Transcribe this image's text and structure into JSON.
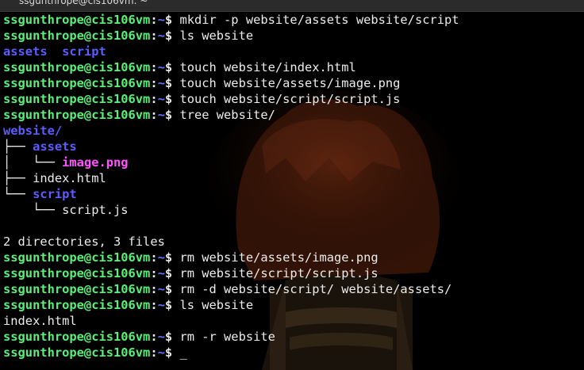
{
  "window": {
    "title": "ssgunthrope@cis106vm: ~"
  },
  "prompt": {
    "user_host": "ssgunthrope@cis106vm",
    "sep": ":",
    "path": "~",
    "symbol": "$ "
  },
  "colors": {
    "prompt_user": "#5af078",
    "prompt_path": "#5c78ff",
    "directory": "#5c5cff",
    "image_file": "#ff55ff",
    "text": "#e8e8e8",
    "background": "#000000"
  },
  "lines": [
    {
      "type": "prompt",
      "command": "mkdir -p website/assets website/script"
    },
    {
      "type": "prompt",
      "command": "ls website"
    },
    {
      "type": "output",
      "segments": [
        {
          "text": "assets",
          "style": "dir"
        },
        {
          "text": "  ",
          "style": "txt"
        },
        {
          "text": "script",
          "style": "dir"
        }
      ]
    },
    {
      "type": "prompt",
      "command": "touch website/index.html"
    },
    {
      "type": "prompt",
      "command": "touch website/assets/image.png"
    },
    {
      "type": "prompt",
      "command": "touch website/script/script.js"
    },
    {
      "type": "prompt",
      "command": "tree website/"
    },
    {
      "type": "output",
      "segments": [
        {
          "text": "website/",
          "style": "dir"
        }
      ]
    },
    {
      "type": "output",
      "segments": [
        {
          "text": "├── ",
          "style": "txt"
        },
        {
          "text": "assets",
          "style": "dir"
        }
      ]
    },
    {
      "type": "output",
      "segments": [
        {
          "text": "│   └── ",
          "style": "txt"
        },
        {
          "text": "image.png",
          "style": "img"
        }
      ]
    },
    {
      "type": "output",
      "segments": [
        {
          "text": "├── index.html",
          "style": "txt"
        }
      ]
    },
    {
      "type": "output",
      "segments": [
        {
          "text": "└── ",
          "style": "txt"
        },
        {
          "text": "script",
          "style": "dir"
        }
      ]
    },
    {
      "type": "output",
      "segments": [
        {
          "text": "    └── script.js",
          "style": "txt"
        }
      ]
    },
    {
      "type": "output",
      "segments": [
        {
          "text": "",
          "style": "txt"
        }
      ]
    },
    {
      "type": "output",
      "segments": [
        {
          "text": "2 directories, 3 files",
          "style": "txt"
        }
      ]
    },
    {
      "type": "prompt",
      "command": "rm website/assets/image.png"
    },
    {
      "type": "prompt",
      "command": "rm website/script/script.js"
    },
    {
      "type": "prompt",
      "command": "rm -d website/script/ website/assets/"
    },
    {
      "type": "prompt",
      "command": "ls website"
    },
    {
      "type": "output",
      "segments": [
        {
          "text": "index.html",
          "style": "txt"
        }
      ]
    },
    {
      "type": "prompt",
      "command": "rm -r website"
    },
    {
      "type": "prompt",
      "command": "",
      "cursor": "_"
    }
  ]
}
